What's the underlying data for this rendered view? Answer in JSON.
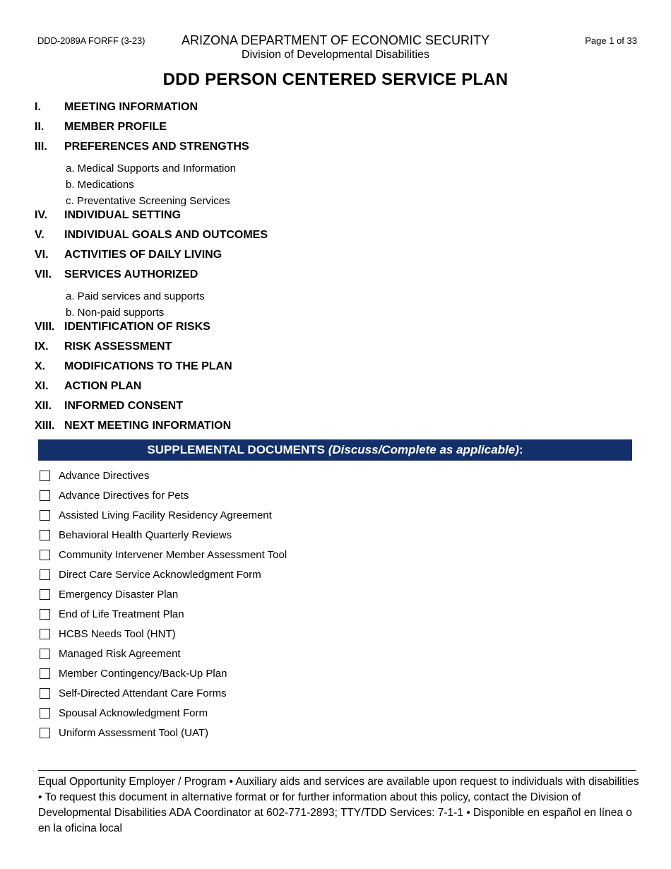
{
  "header": {
    "form_number": "DDD-2089A FORFF (3-23)",
    "page_indicator": "Page 1 of 33",
    "agency_name": "ARIZONA DEPARTMENT OF ECONOMIC SECURITY",
    "division_name": "Division of Developmental Disabilities",
    "document_title": "DDD PERSON CENTERED SERVICE PLAN"
  },
  "toc": [
    {
      "numeral": "I.",
      "label": "MEETING INFORMATION",
      "subitems": []
    },
    {
      "numeral": "II.",
      "label": "MEMBER PROFILE",
      "subitems": []
    },
    {
      "numeral": "III.",
      "label": "PREFERENCES AND STRENGTHS",
      "subitems": [
        "a. Medical Supports and Information",
        "b. Medications",
        "c. Preventative Screening Services"
      ]
    },
    {
      "numeral": "IV.",
      "label": "INDIVIDUAL SETTING",
      "subitems": []
    },
    {
      "numeral": "V.",
      "label": "INDIVIDUAL GOALS AND OUTCOMES",
      "subitems": []
    },
    {
      "numeral": "VI.",
      "label": "ACTIVITIES OF DAILY LIVING",
      "subitems": []
    },
    {
      "numeral": "VII.",
      "label": "SERVICES AUTHORIZED",
      "subitems": [
        "a. Paid services and supports",
        "b. Non-paid supports"
      ]
    },
    {
      "numeral": "VIII.",
      "label": "IDENTIFICATION OF RISKS",
      "subitems": []
    },
    {
      "numeral": "IX.",
      "label": "RISK ASSESSMENT",
      "subitems": []
    },
    {
      "numeral": "X.",
      "label": "MODIFICATIONS TO THE PLAN",
      "subitems": []
    },
    {
      "numeral": "XI.",
      "label": "ACTION PLAN",
      "subitems": []
    },
    {
      "numeral": "XII.",
      "label": "INFORMED CONSENT",
      "subitems": []
    },
    {
      "numeral": "XIII.",
      "label": "NEXT MEETING INFORMATION",
      "subitems": []
    }
  ],
  "supplemental": {
    "banner_title": "SUPPLEMENTAL DOCUMENTS ",
    "banner_italic": "(Discuss/Complete as applicable)",
    "banner_suffix": ":",
    "banner_color": "#14306b",
    "items": [
      {
        "label": "Advance Directives",
        "checked": false
      },
      {
        "label": "Advance Directives for Pets",
        "checked": false
      },
      {
        "label": "Assisted Living Facility Residency Agreement",
        "checked": false
      },
      {
        "label": "Behavioral Health Quarterly Reviews",
        "checked": false
      },
      {
        "label": "Community Intervener Member Assessment Tool",
        "checked": false
      },
      {
        "label": "Direct Care Service Acknowledgment Form",
        "checked": false
      },
      {
        "label": "Emergency Disaster Plan",
        "checked": false
      },
      {
        "label": "End of Life Treatment Plan",
        "checked": false
      },
      {
        "label": "HCBS Needs Tool (HNT)",
        "checked": false
      },
      {
        "label": "Managed Risk Agreement",
        "checked": false
      },
      {
        "label": "Member Contingency/Back-Up Plan",
        "checked": false
      },
      {
        "label": "Self-Directed Attendant Care Forms",
        "checked": false
      },
      {
        "label": "Spousal Acknowledgment Form",
        "checked": false
      },
      {
        "label": "Uniform Assessment Tool (UAT)",
        "checked": false
      }
    ]
  },
  "footer": {
    "text": "Equal Opportunity Employer / Program • Auxiliary aids and services are available upon request to individuals with disabilities • To request this document in alternative format or for further information about this policy, contact the Division of Developmental Disabilities ADA Coordinator at 602-771-2893; TTY/TDD Services: 7-1-1 • Disponible en español en línea o en la oficina local"
  }
}
